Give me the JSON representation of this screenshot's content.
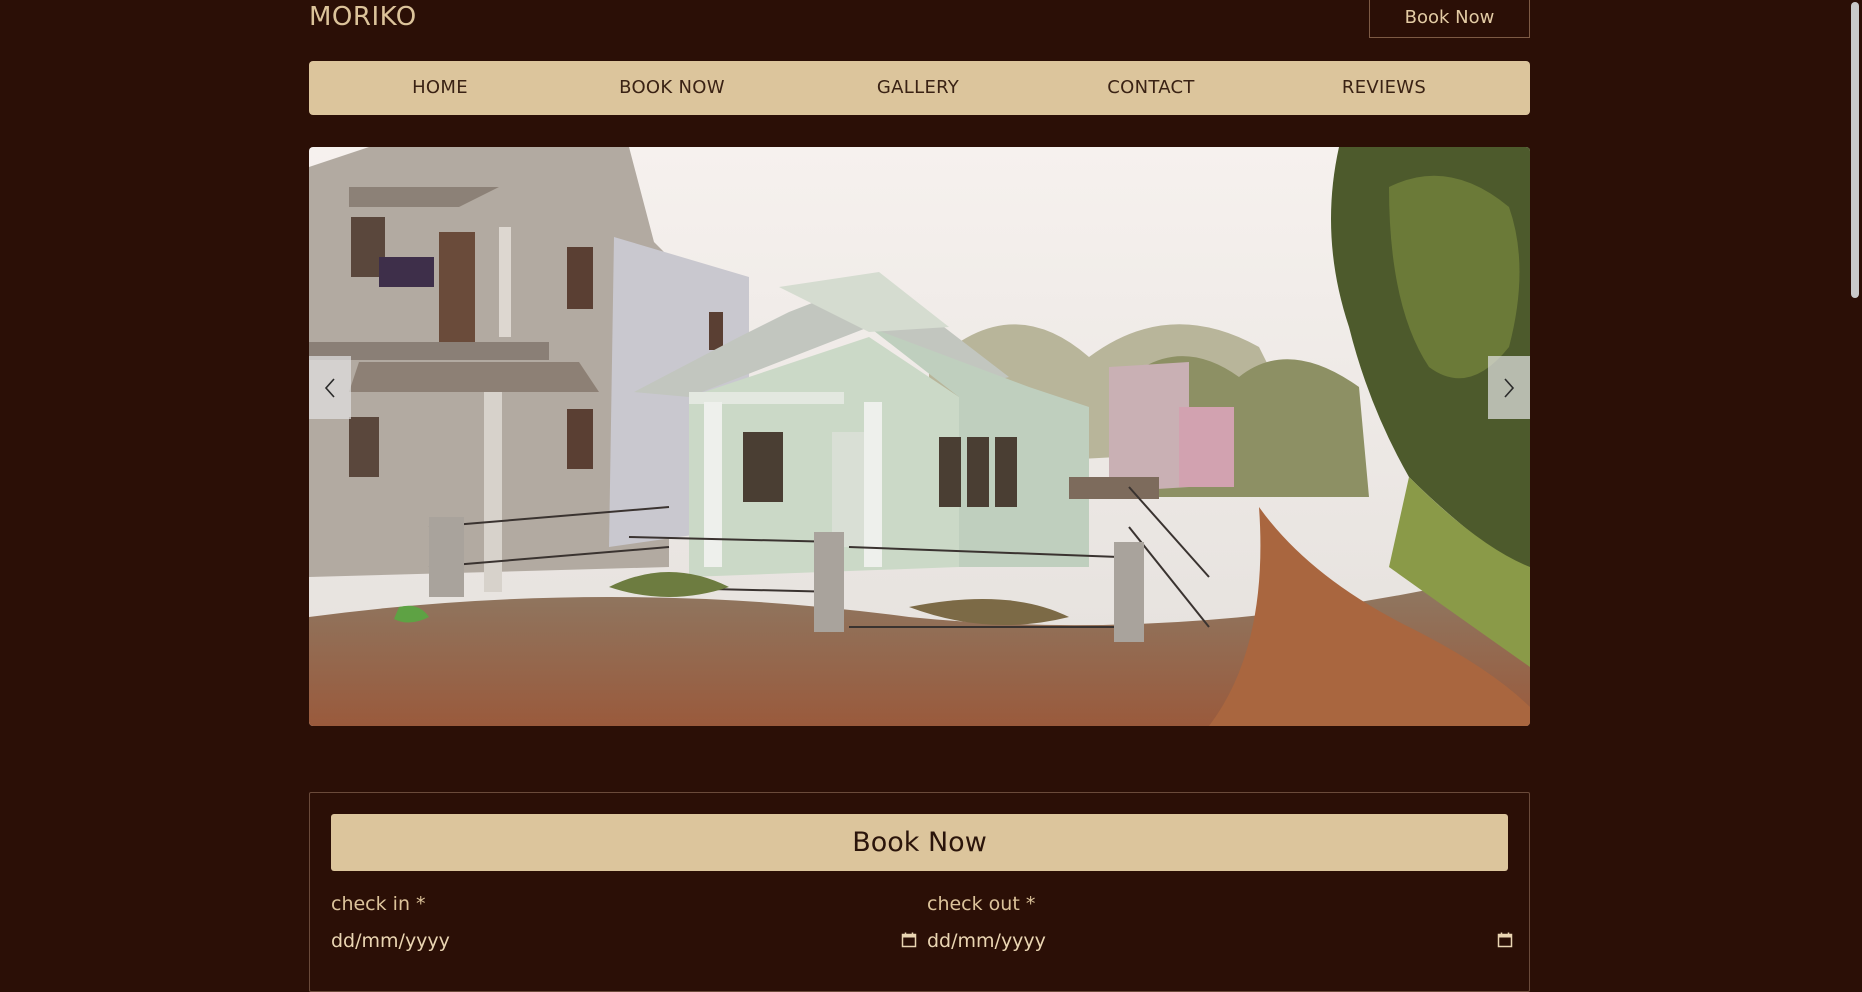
{
  "header": {
    "brand": "MORIKO",
    "book_button": "Book Now"
  },
  "nav": {
    "items": [
      {
        "label": "HOME"
      },
      {
        "label": "BOOK NOW"
      },
      {
        "label": "GALLERY"
      },
      {
        "label": "CONTACT"
      },
      {
        "label": "REVIEWS"
      }
    ]
  },
  "carousel": {
    "prev_icon": "chevron-left-icon",
    "next_icon": "chevron-right-icon"
  },
  "booking": {
    "title": "Book Now",
    "check_in_label": "check in *",
    "check_out_label": "check out *",
    "check_in_placeholder": "dd/mm/yyyy",
    "check_out_placeholder": "dd/mm/yyyy",
    "calendar_icon": "calendar-icon"
  },
  "colors": {
    "background": "#2b0f06",
    "accent": "#dcc59c",
    "text": "#dcc39a"
  }
}
